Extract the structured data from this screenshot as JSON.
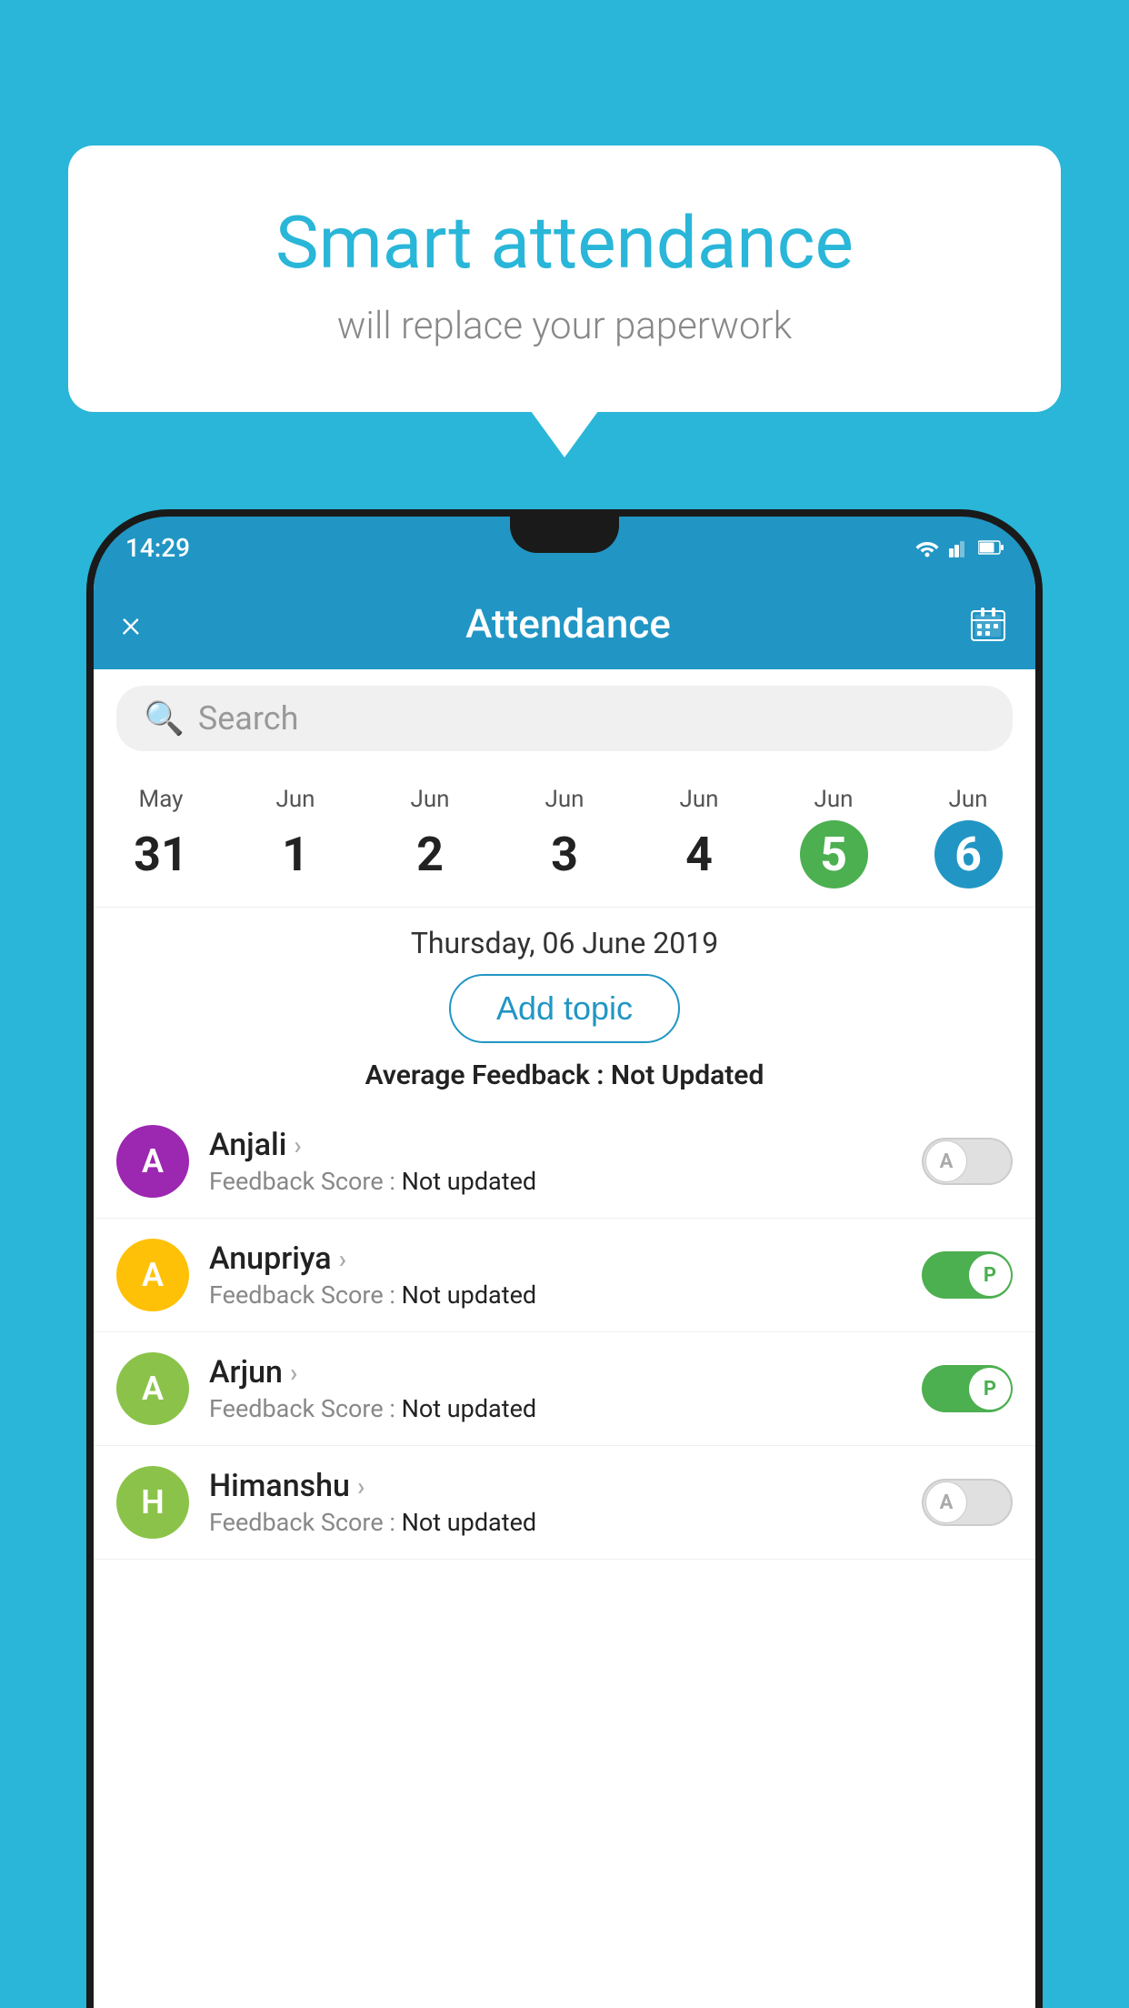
{
  "background": {
    "color": "#29b6d8"
  },
  "speech_bubble": {
    "title": "Smart attendance",
    "subtitle": "will replace your paperwork"
  },
  "status_bar": {
    "time": "14:29"
  },
  "app_bar": {
    "title": "Attendance",
    "close_label": "×",
    "calendar_label": "📅"
  },
  "search": {
    "placeholder": "Search"
  },
  "calendar": {
    "days": [
      {
        "month": "May",
        "date": "31",
        "style": "normal"
      },
      {
        "month": "Jun",
        "date": "1",
        "style": "normal"
      },
      {
        "month": "Jun",
        "date": "2",
        "style": "normal"
      },
      {
        "month": "Jun",
        "date": "3",
        "style": "normal"
      },
      {
        "month": "Jun",
        "date": "4",
        "style": "normal"
      },
      {
        "month": "Jun",
        "date": "5",
        "style": "today"
      },
      {
        "month": "Jun",
        "date": "6",
        "style": "selected"
      }
    ]
  },
  "selected_date": {
    "label": "Thursday, 06 June 2019"
  },
  "add_topic": {
    "label": "Add topic"
  },
  "average_feedback": {
    "label": "Average Feedback : ",
    "value": "Not Updated"
  },
  "students": [
    {
      "name": "Anjali",
      "avatar_letter": "A",
      "avatar_color": "#9c27b0",
      "feedback": "Feedback Score : ",
      "feedback_value": "Not updated",
      "attendance": "absent",
      "toggle_letter": "A"
    },
    {
      "name": "Anupriya",
      "avatar_letter": "A",
      "avatar_color": "#ffc107",
      "feedback": "Feedback Score : ",
      "feedback_value": "Not updated",
      "attendance": "present",
      "toggle_letter": "P"
    },
    {
      "name": "Arjun",
      "avatar_letter": "A",
      "avatar_color": "#8bc34a",
      "feedback": "Feedback Score : ",
      "feedback_value": "Not updated",
      "attendance": "present",
      "toggle_letter": "P"
    },
    {
      "name": "Himanshu",
      "avatar_letter": "H",
      "avatar_color": "#8bc34a",
      "feedback": "Feedback Score : ",
      "feedback_value": "Not updated",
      "attendance": "absent",
      "toggle_letter": "A"
    }
  ]
}
